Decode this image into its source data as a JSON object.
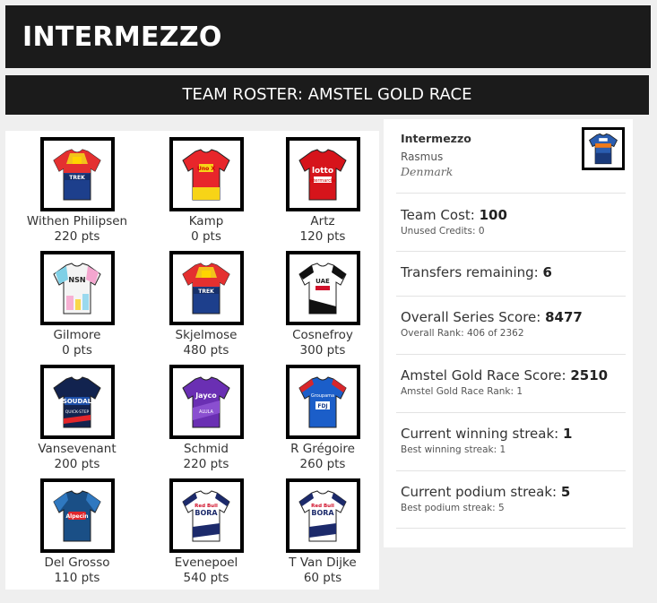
{
  "brand": {
    "title": "INTERMEZZO"
  },
  "section": {
    "title": "TEAM ROSTER: AMSTEL GOLD RACE"
  },
  "riders": [
    {
      "name": "Withen Philipsen",
      "points": "220 pts",
      "jersey": "lidl-trek-jersey-icon"
    },
    {
      "name": "Kamp",
      "points": "0 pts",
      "jersey": "uno-x-jersey-icon"
    },
    {
      "name": "Artz",
      "points": "120 pts",
      "jersey": "lotto-jersey-icon"
    },
    {
      "name": "Gilmore",
      "points": "0 pts",
      "jersey": "nsn-jersey-icon"
    },
    {
      "name": "Skjelmose",
      "points": "480 pts",
      "jersey": "lidl-trek-jersey-icon"
    },
    {
      "name": "Cosnefroy",
      "points": "300 pts",
      "jersey": "uae-jersey-icon"
    },
    {
      "name": "Vansevenant",
      "points": "200 pts",
      "jersey": "soudal-quickstep-jersey-icon"
    },
    {
      "name": "Schmid",
      "points": "220 pts",
      "jersey": "jayco-alula-jersey-icon"
    },
    {
      "name": "R Grégoire",
      "points": "260 pts",
      "jersey": "groupama-fdj-jersey-icon"
    },
    {
      "name": "Del Grosso",
      "points": "110 pts",
      "jersey": "alpecin-jersey-icon"
    },
    {
      "name": "Evenepoel",
      "points": "540 pts",
      "jersey": "red-bull-bora-jersey-icon"
    },
    {
      "name": "T Van Dijke",
      "points": "60 pts",
      "jersey": "red-bull-bora-jersey-icon"
    }
  ],
  "team": {
    "name": "Intermezzo",
    "manager": "Rasmus",
    "country": "Denmark",
    "jersey": "team-jersey-icon"
  },
  "stats": [
    {
      "label": "Team Cost: ",
      "value": "100",
      "sub": "Unused Credits: 0"
    },
    {
      "label": "Transfers remaining: ",
      "value": "6",
      "sub": ""
    },
    {
      "label": "Overall Series Score: ",
      "value": "8477",
      "sub": "Overall Rank: 406 of 2362"
    },
    {
      "label": "Amstel Gold Race Score: ",
      "value": "2510",
      "sub": "Amstel Gold Race Rank: 1"
    },
    {
      "label": "Current winning streak: ",
      "value": "1",
      "sub": "Best winning streak: 1"
    },
    {
      "label": "Current podium streak: ",
      "value": "5",
      "sub": "Best podium streak: 5"
    }
  ],
  "colors": {
    "header_bg": "#1b1b1b",
    "page_bg": "#efefef",
    "panel_bg": "#ffffff"
  }
}
